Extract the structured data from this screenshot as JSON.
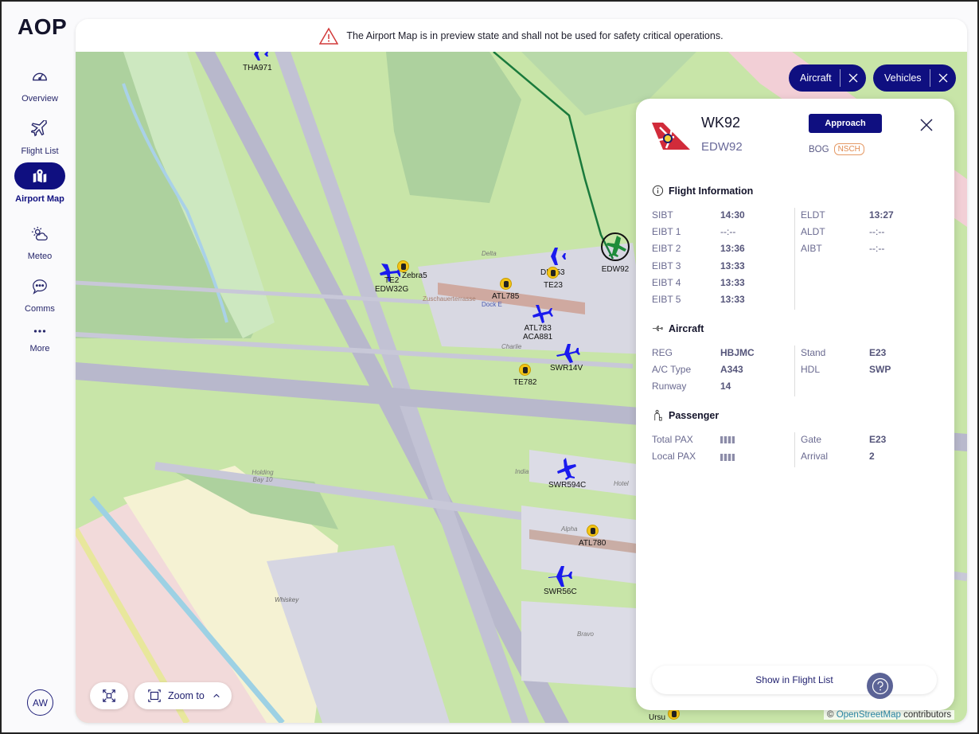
{
  "app": {
    "logo": "AOP"
  },
  "sidebar": {
    "items": [
      {
        "label": "Overview",
        "icon": "speedometer-icon"
      },
      {
        "label": "Flight List",
        "icon": "airplane-icon"
      },
      {
        "label": "Airport Map",
        "icon": "map-pin-icon",
        "active": true
      },
      {
        "label": "Meteo",
        "icon": "weather-icon"
      },
      {
        "label": "Comms",
        "icon": "chat-bubble-icon"
      },
      {
        "label": "More",
        "icon": "more-dots-icon"
      }
    ],
    "user_initials": "AW"
  },
  "banner": {
    "icon": "warning-triangle-icon",
    "text": "The Airport Map is in preview state and shall not be used for safety critical operations."
  },
  "filters": [
    {
      "label": "Aircraft"
    },
    {
      "label": "Vehicles"
    }
  ],
  "map": {
    "aircraft_markers": [
      {
        "label": "THA971"
      },
      {
        "label": "TE2"
      },
      {
        "label": "EDW32G"
      },
      {
        "label": "DLA53"
      },
      {
        "label": "ATL783"
      },
      {
        "label": "ACA881"
      },
      {
        "label": "SWR14V"
      },
      {
        "label": "SWR594C"
      },
      {
        "label": "SWR56C"
      },
      {
        "label": "EDW92",
        "selected": true
      }
    ],
    "vehicle_markers": [
      {
        "label": "Zebra5"
      },
      {
        "label": "TE23"
      },
      {
        "label": "ATL785"
      },
      {
        "label": "TE782"
      },
      {
        "label": "ATL780"
      },
      {
        "label": "Ursu"
      }
    ],
    "place_labels": [
      "Dock E",
      "Zuschauerterrasse",
      "Alpha",
      "India",
      "Hotel",
      "Whiskey",
      "Charlie",
      "Delta",
      "Bravo",
      "Holding Bay 10"
    ],
    "attribution_prefix": "©",
    "attribution_link": "OpenStreetMap",
    "attribution_suffix": "contributors"
  },
  "controls": {
    "fit_icon": "fit-screen-icon",
    "zoom_to_label": "Zoom to",
    "help_icon": "help-icon"
  },
  "flight": {
    "callsign": "WK92",
    "icao": "EDW92",
    "status": "Approach",
    "origin": "BOG",
    "badge": "NSCH",
    "sections": {
      "flight_info": {
        "title": "Flight Information",
        "left": [
          {
            "k": "SIBT",
            "v": "14:30"
          },
          {
            "k": "EIBT 1",
            "v": "--:--"
          },
          {
            "k": "EIBT 2",
            "v": "13:36"
          },
          {
            "k": "EIBT 3",
            "v": "13:33"
          },
          {
            "k": "EIBT 4",
            "v": "13:33"
          },
          {
            "k": "EIBT 5",
            "v": "13:33"
          }
        ],
        "right": [
          {
            "k": "ELDT",
            "v": "13:27"
          },
          {
            "k": "ALDT",
            "v": "--:--"
          },
          {
            "k": "AIBT",
            "v": "--:--"
          }
        ]
      },
      "aircraft": {
        "title": "Aircraft",
        "left": [
          {
            "k": "REG",
            "v": "HBJMC"
          },
          {
            "k": "A/C Type",
            "v": "A343"
          },
          {
            "k": "Runway",
            "v": "14"
          }
        ],
        "right": [
          {
            "k": "Stand",
            "v": "E23"
          },
          {
            "k": "HDL",
            "v": "SWP"
          }
        ]
      },
      "passenger": {
        "title": "Passenger",
        "left": [
          {
            "k": "Total PAX",
            "v": ""
          },
          {
            "k": "Local PAX",
            "v": ""
          }
        ],
        "right": [
          {
            "k": "Gate",
            "v": "E23"
          },
          {
            "k": "Arrival",
            "v": "2"
          }
        ]
      }
    },
    "show_button": "Show in Flight List"
  },
  "colors": {
    "primary": "#0f0f80",
    "aircraft": "#1a1aee",
    "selected_aircraft": "#1e8c3a",
    "vehicle": "#f3c416",
    "warning": "#d23a3a"
  }
}
